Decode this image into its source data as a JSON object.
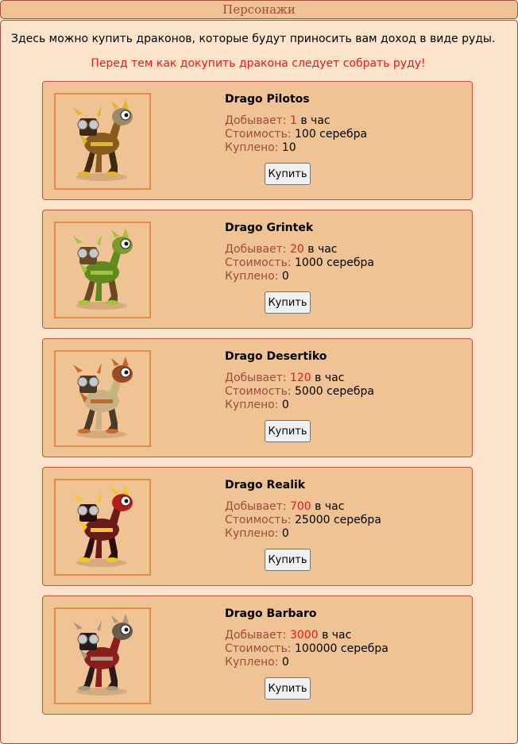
{
  "header": {
    "title": "Персонажи"
  },
  "intro_text": "Здесь можно купить драконов, которые будут приносить вам доход в виде руды.",
  "warning_text": "Перед тем как докупить дракона следует собрать руду!",
  "labels": {
    "produces": "Добывает:",
    "per_hour": "в час",
    "cost": "Стоимость:",
    "bought": "Куплено:",
    "buy_button": "Купить"
  },
  "dragons": [
    {
      "name": "Drago Pilotos",
      "produces": "1",
      "cost": "100 серебра",
      "bought": "10",
      "colors": {
        "body": "#8a5a1c",
        "accent": "#e2b52c",
        "dark": "#3e2a10",
        "head": "#9a8a6a"
      }
    },
    {
      "name": "Drago Grintek",
      "produces": "20",
      "cost": "1000 серебра",
      "bought": "0",
      "colors": {
        "body": "#5e8a1e",
        "accent": "#a0c43a",
        "dark": "#6a4a22",
        "head": "#7a9a2a"
      }
    },
    {
      "name": "Drago Desertiko",
      "produces": "120",
      "cost": "5000 серебра",
      "bought": "0",
      "colors": {
        "body": "#c9b281",
        "accent": "#c8682a",
        "dark": "#4a3a2a",
        "head": "#9a4a1e"
      }
    },
    {
      "name": "Drago Realik",
      "produces": "700",
      "cost": "25000 серебра",
      "bought": "0",
      "colors": {
        "body": "#6a1a1a",
        "accent": "#f2c91c",
        "dark": "#2a0e0e",
        "head": "#b51d1d"
      }
    },
    {
      "name": "Drago Barbaro",
      "produces": "3000",
      "cost": "100000 серебра",
      "bought": "0",
      "colors": {
        "body": "#8a1e1e",
        "accent": "#a89a7a",
        "dark": "#2a1a1a",
        "head": "#6a5a4a"
      }
    }
  ]
}
